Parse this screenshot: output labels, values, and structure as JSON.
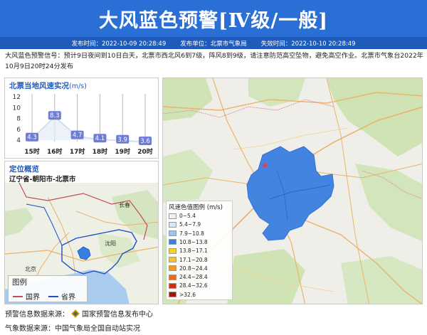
{
  "header": {
    "title": "大风蓝色预警[Ⅳ级/一般]",
    "publish_time": "发布时间：2022-10-09 20:28:49",
    "publisher": "发布单位：北票市气象局",
    "expire_time": "失效时间：2022-10-10 20:28:49"
  },
  "description": "大风蓝色预警信号：预计9日夜间到10日白天，北票市西北风6到7级，阵风8到9级，请注意防范高空坠物，避免高空作业。北票市气象台2022年10月9日20时24分发布",
  "wind_panel": {
    "title": "北票当地风速实况",
    "unit": "(m/s)"
  },
  "chart_data": {
    "type": "line",
    "title": "北票当地风速实况(m/s)",
    "categories": [
      "15时",
      "16时",
      "17时",
      "18时",
      "19时",
      "20时"
    ],
    "values": [
      4.3,
      8.3,
      4.7,
      4.1,
      3.9,
      3.6
    ],
    "ylim": [
      4,
      12
    ],
    "yticks": [
      4,
      6,
      8,
      10,
      12
    ],
    "grid": true,
    "line_color": "#c8d6ec",
    "label_color": "#6f7dd6"
  },
  "location_panel": {
    "title": "定位概览",
    "path": "辽宁省-朝阳市-北票市"
  },
  "small_map": {
    "labels": [
      "沈阳",
      "长春",
      "北京"
    ]
  },
  "boundary_legend": {
    "title": "图例",
    "items": [
      {
        "label": "国界",
        "color": "#c24b5a"
      },
      {
        "label": "省界",
        "color": "#1f4fc2"
      }
    ]
  },
  "color_legend": {
    "title": "风速色值图例 (m/s)",
    "items": [
      {
        "label": "0~5.4",
        "color": "#f2f2f2"
      },
      {
        "label": "5.4~7.9",
        "color": "#d5e6f8"
      },
      {
        "label": "7.9~10.8",
        "color": "#9cc4f0"
      },
      {
        "label": "10.8~13.8",
        "color": "#3a7fe0"
      },
      {
        "label": "13.8~17.1",
        "color": "#f3d323"
      },
      {
        "label": "17.1~20.8",
        "color": "#f6c23a"
      },
      {
        "label": "20.8~24.4",
        "color": "#f39a1e"
      },
      {
        "label": "24.4~28.4",
        "color": "#ee6a16"
      },
      {
        "label": "28.4~32.6",
        "color": "#d42a12"
      },
      {
        "label": ">32.6",
        "color": "#a4120c"
      }
    ]
  },
  "footer": {
    "source_warning": "预警信息数据来源：",
    "source_warning_org": "国家预警信息发布中心",
    "source_weather": "气象数据来源：中国气象局全国自动站实况"
  }
}
